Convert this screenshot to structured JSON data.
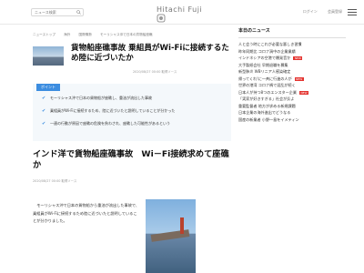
{
  "header": {
    "search_placeholder": "ニュース検索",
    "logo_text": "Hitachi Fuji",
    "links": [
      "ログイン",
      "会員登録"
    ]
  },
  "breadcrumb": [
    "ニューストップ",
    "海外",
    "国際情勢",
    "モーリシャス沖で日本の貨物船座礁"
  ],
  "lead": {
    "title": "貨物船座礁事故 乗組員がWi-Fiに接続するため陸に近づいたか",
    "date": "2020/08/27 00:00 取得ソース"
  },
  "summary": {
    "badge": "ポイント",
    "items": [
      "モーリシャス沖で日本の貨物船が座礁し、重油が流出した事故",
      "乗組員がWi-Fiに接続するため、陸に近づいたと説明していることが分かった",
      "一連の行動が原因で座礁の危険を負わされ、座礁した可能性があるという"
    ]
  },
  "article": {
    "headline": "インド洋で貨物船座礁事故　Wi－Fi接続求めて座礁か",
    "meta": "2020/08/27 00:00 取得ソース",
    "body": "　モーリシャス沖で日本の貨物船から重油が流出した事故で、乗組員がWi-Fiに接続するため陸に近づいたと説明していることが分かりました。"
  },
  "sidebar": {
    "heading": "本日のニュース",
    "items": [
      {
        "text": "人と会う時にこれが必要な悪しき習慣",
        "new": false
      },
      {
        "text": "昨年同期比 コロナ渦中の企業業績",
        "new": false
      },
      {
        "text": "インドネシアの空港で爆発音か",
        "new": true
      },
      {
        "text": "大手製紙会社 早期退職を募集",
        "new": false
      },
      {
        "text": "新型肺炎 WBリニア人感染確定",
        "new": false
      },
      {
        "text": "帰ってくれ!に一斉に行進の人が",
        "new": true
      },
      {
        "text": "世界の港湾 コロナ禍で混乱が続く",
        "new": false
      },
      {
        "text": "日本人が持つ8つのエンスター企業",
        "new": true
      },
      {
        "text": "「実家が好きすぎる」社会が反よ",
        "new": false
      },
      {
        "text": "重要監督者 地方が求める新規課題",
        "new": false
      },
      {
        "text": "日本企業の海外進出でどうなる",
        "new": false
      },
      {
        "text": "国産の新業者 小野一島をイメティン",
        "new": false
      }
    ]
  }
}
